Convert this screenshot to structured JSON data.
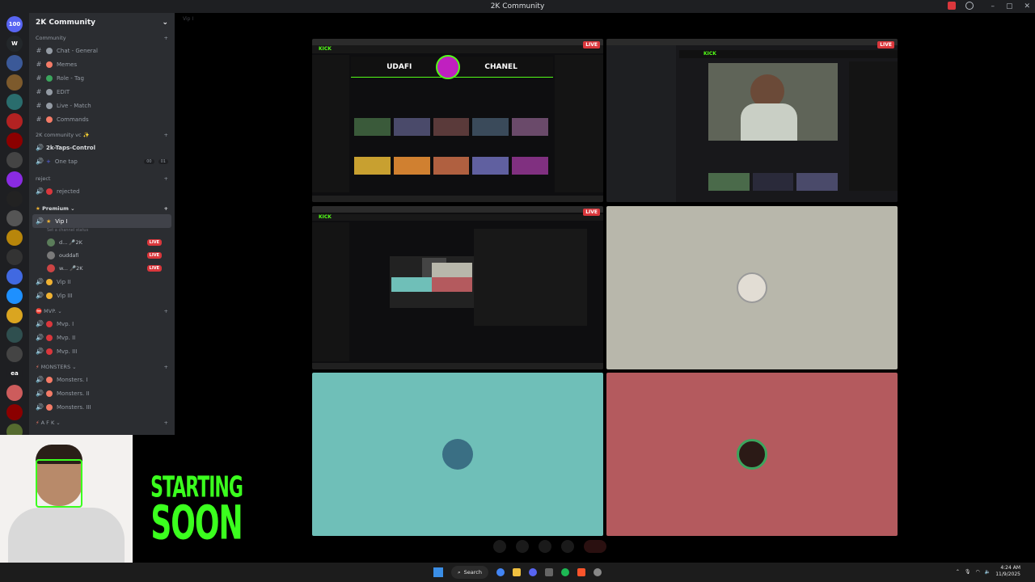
{
  "window": {
    "title": "2K Community"
  },
  "server_rail": {
    "items": [
      {
        "name": "direct-messages",
        "label": "100",
        "color": "#5865f2"
      },
      {
        "name": "server-w",
        "label": "W",
        "color": "#23272a"
      },
      {
        "name": "server-a",
        "label": "",
        "color": "#3b5998"
      },
      {
        "name": "server-b",
        "label": "",
        "color": "#7d5a2c"
      },
      {
        "name": "server-c",
        "label": "",
        "color": "#2a6d6d"
      },
      {
        "name": "server-d",
        "label": "",
        "color": "#b22222"
      },
      {
        "name": "server-e",
        "label": "",
        "color": "#8b0000"
      },
      {
        "name": "server-f",
        "label": "",
        "color": "#444"
      },
      {
        "name": "server-g",
        "label": "",
        "color": "#8a2be2"
      },
      {
        "name": "server-h",
        "label": "",
        "color": "#222"
      },
      {
        "name": "server-i",
        "label": "",
        "color": "#555"
      },
      {
        "name": "server-j",
        "label": "",
        "color": "#b8860b"
      },
      {
        "name": "server-k",
        "label": "",
        "color": "#333"
      },
      {
        "name": "server-l",
        "label": "",
        "color": "#4169e1"
      },
      {
        "name": "server-m",
        "label": "",
        "color": "#1e90ff"
      },
      {
        "name": "server-n",
        "label": "",
        "color": "#daa520"
      },
      {
        "name": "server-o",
        "label": "",
        "color": "#2f4f4f"
      },
      {
        "name": "server-p",
        "label": "",
        "color": "#444"
      },
      {
        "name": "server-ea",
        "label": "ea",
        "color": "#1e1f22"
      },
      {
        "name": "server-q",
        "label": "",
        "color": "#cd5c5c"
      },
      {
        "name": "server-r",
        "label": "",
        "color": "#8b0000"
      },
      {
        "name": "server-s",
        "label": "",
        "color": "#556b2f"
      }
    ]
  },
  "sidebar": {
    "guild_name": "2K Community",
    "categories": [
      {
        "label": "Community",
        "channels": [
          {
            "label": "Chat - General",
            "color": "#949ba4",
            "type": "text"
          },
          {
            "label": "Memes",
            "color": "#f47b67",
            "type": "text"
          },
          {
            "label": "Role - Tag",
            "color": "#3ba55d",
            "type": "text"
          },
          {
            "label": "EDIT",
            "color": "#949ba4",
            "type": "text"
          },
          {
            "label": "Live - Match",
            "color": "#949ba4",
            "type": "text"
          },
          {
            "label": "Commands",
            "color": "#f47b67",
            "type": "text"
          }
        ]
      }
    ],
    "vc_category": "2K community vc ✨",
    "vc_channels": [
      {
        "label": "2k-Taps-Control",
        "bold": true
      },
      {
        "label": "One tap",
        "badge1": "00",
        "badge2": "01"
      }
    ],
    "reject_category": "reject",
    "reject_channels": [
      {
        "label": "rejected"
      }
    ],
    "premium_category": "Premium",
    "vip1": {
      "label": "Vip I",
      "status": "Set a channel status"
    },
    "members": [
      {
        "label": "d... 🎤2K",
        "live": "LIVE",
        "color": "#5b7d5a"
      },
      {
        "label": "ouddafi",
        "live": "LIVE",
        "color": "#7a7a7a"
      },
      {
        "label": "w... 🎤2K",
        "live": "LIVE",
        "color": "#c44"
      }
    ],
    "vip_channels": [
      {
        "label": "Vip II"
      },
      {
        "label": "Vip III"
      }
    ],
    "mvp_category": "MVP.",
    "mvp_channels": [
      {
        "label": "Mvp. I"
      },
      {
        "label": "Mvp. II"
      },
      {
        "label": "Mvp. III"
      }
    ],
    "monsters_category": "MONSTERS",
    "monsters_channels": [
      {
        "label": "Monsters. I"
      },
      {
        "label": "Monsters. II"
      },
      {
        "label": "Monsters. III"
      }
    ],
    "afk_category": "A F K"
  },
  "channel_header": {
    "title": "Vip I"
  },
  "stage": {
    "tiles": [
      {
        "name": "stream-tile-1",
        "live": "LIVE",
        "bg": "#0e0e10"
      },
      {
        "name": "stream-tile-2",
        "live": "LIVE",
        "bg": "#18181b"
      },
      {
        "name": "stream-tile-3",
        "live": "LIVE",
        "bg": "#0e0e10"
      },
      {
        "name": "participant-tile-1",
        "live": "",
        "bg": "#b8b7ab"
      },
      {
        "name": "participant-tile-2",
        "live": "",
        "bg": "#6fbfb8"
      },
      {
        "name": "participant-tile-3",
        "live": "",
        "bg": "#b45a5e"
      }
    ],
    "kick_header": "UDAFI",
    "kick_header2": "CHANEL"
  },
  "overlay": {
    "starting_line1": "STARTING",
    "starting_line2": "SOON"
  },
  "taskbar": {
    "search_label": "Search",
    "time": "4:24 AM",
    "date": "11/9/2025"
  }
}
